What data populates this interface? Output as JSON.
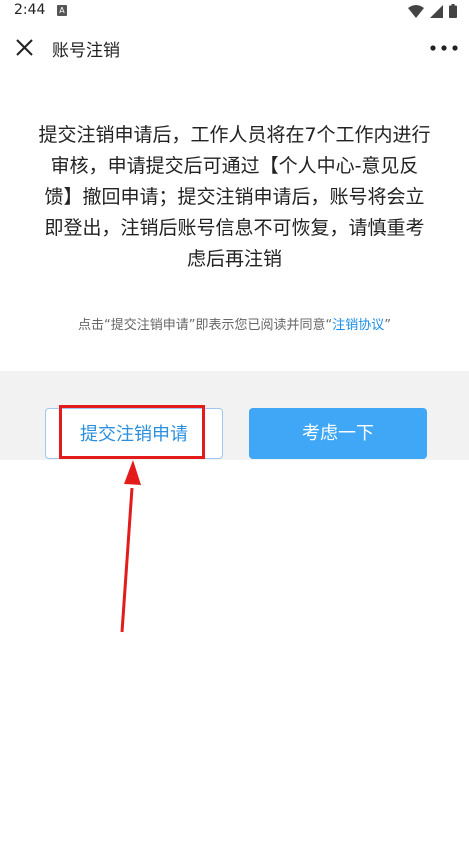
{
  "status_bar": {
    "time": "2:44",
    "indicator": "A"
  },
  "nav": {
    "title": "账号注销"
  },
  "notice": {
    "lines": [
      "提交注销申请后，工作人员将在7个工作内进行",
      "审核，申请提交后可通过【个人中心-意见反",
      "馈】撤回申请；提交注销申请后，账号将会立",
      "即登出，注销后账号信息不可恢复，请慎重考",
      "虑后再注销"
    ]
  },
  "agreement": {
    "prefix": "点击“提交注销申请”即表示您已阅读并同意“",
    "link": "注销协议",
    "suffix": "”"
  },
  "buttons": {
    "submit": "提交注销申请",
    "think": "考虑一下"
  },
  "colors": {
    "accent": "#3fa7f5",
    "link": "#1a8ee8",
    "highlight": "#e31b1b"
  }
}
